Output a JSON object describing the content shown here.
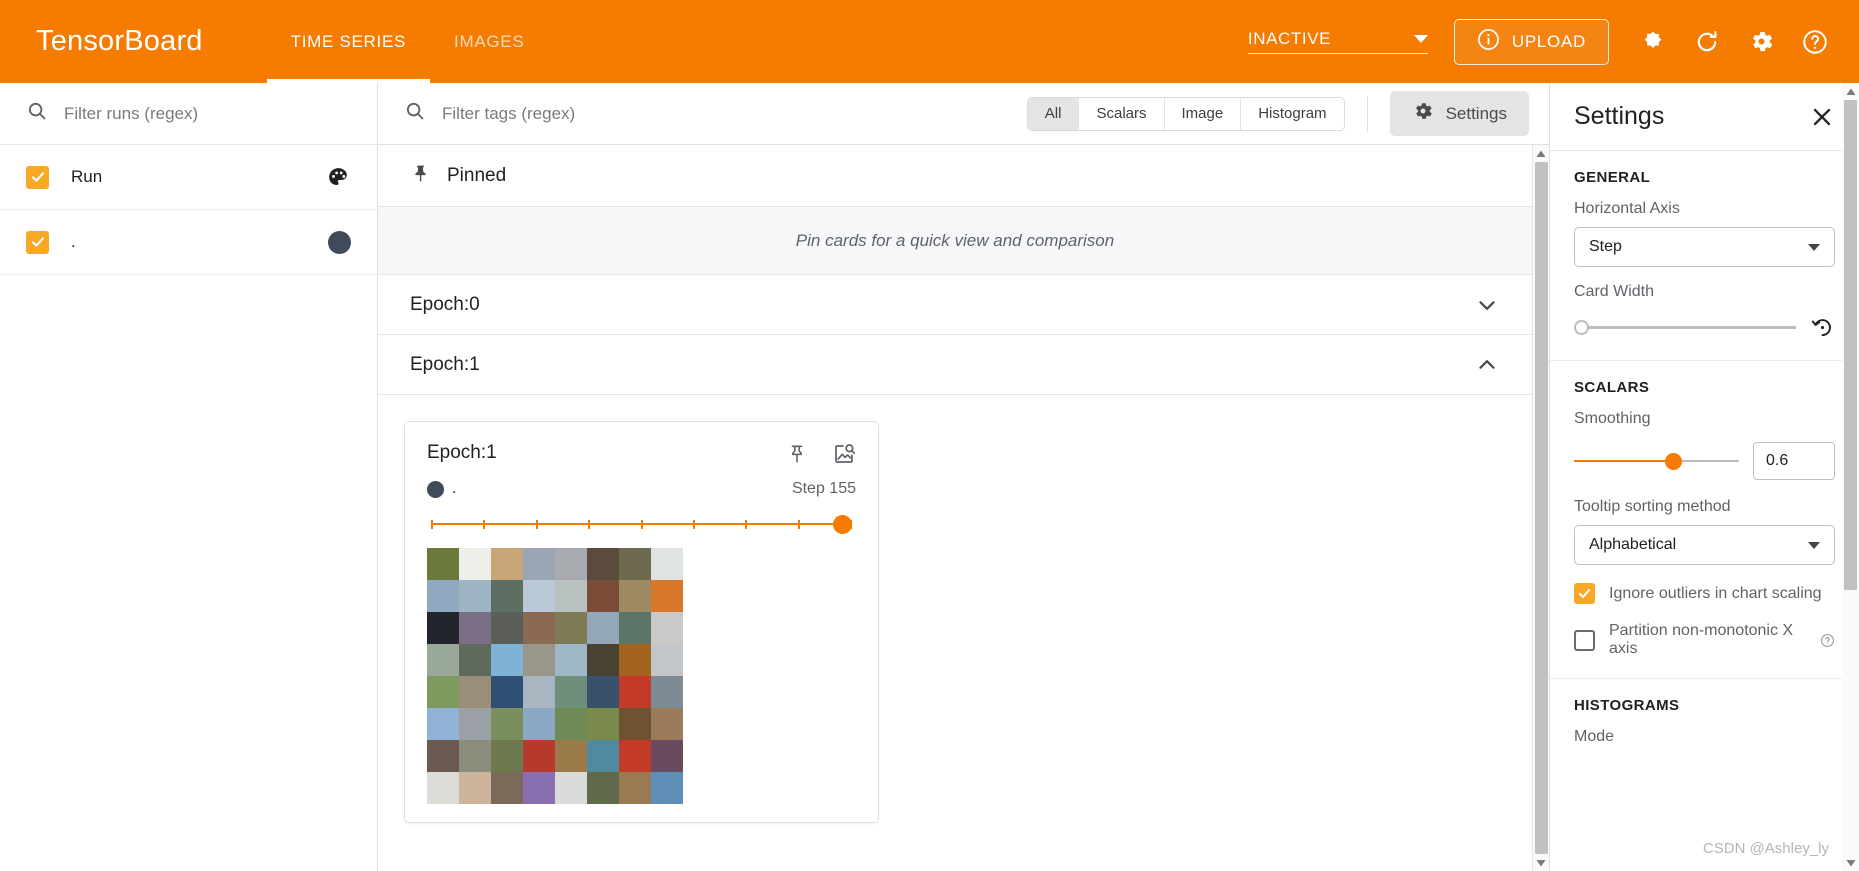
{
  "header": {
    "brand": "TensorBoard",
    "tabs": [
      {
        "label": "TIME SERIES",
        "active": true
      },
      {
        "label": "IMAGES",
        "active": false
      }
    ],
    "run_status": "INACTIVE",
    "upload_label": "UPLOAD",
    "icons": [
      "info-icon",
      "brightness-icon",
      "refresh-icon",
      "gear-icon",
      "help-icon"
    ],
    "accent_color": "#f57c00"
  },
  "sidebar": {
    "search_placeholder": "Filter runs (regex)",
    "runs_header": "Run",
    "runs": [
      {
        "label": ".",
        "checked": true,
        "color": "#3f4b5b"
      }
    ],
    "header_checked": true,
    "checkbox_color": "#f9a825"
  },
  "toolbar": {
    "tag_search_placeholder": "Filter tags (regex)",
    "filters": [
      {
        "label": "All",
        "active": true
      },
      {
        "label": "Scalars",
        "active": false
      },
      {
        "label": "Image",
        "active": false
      },
      {
        "label": "Histogram",
        "active": false
      }
    ],
    "settings_label": "Settings"
  },
  "main": {
    "pinned_title": "Pinned",
    "pinned_empty_text": "Pin cards for a quick view and comparison",
    "groups": [
      {
        "title": "Epoch:0",
        "expanded": false
      },
      {
        "title": "Epoch:1",
        "expanded": true
      }
    ],
    "card": {
      "title": "Epoch:1",
      "run_name": ".",
      "run_color": "#3f4b5b",
      "step_label": "Step 155",
      "slider_value": 155,
      "slider_ticks": 9,
      "grid_rows": 8,
      "grid_cols": 8
    }
  },
  "settings": {
    "title": "Settings",
    "close_icon": "close-icon",
    "sections": {
      "general": {
        "heading": "GENERAL",
        "horizontal_axis_label": "Horizontal Axis",
        "horizontal_axis_value": "Step",
        "card_width_label": "Card Width",
        "card_width_value": 0,
        "reset_icon": "reset-icon"
      },
      "scalars": {
        "heading": "SCALARS",
        "smoothing_label": "Smoothing",
        "smoothing_value": "0.6",
        "tooltip_sort_label": "Tooltip sorting method",
        "tooltip_sort_value": "Alphabetical",
        "ignore_outliers_label": "Ignore outliers in chart scaling",
        "ignore_outliers_checked": true,
        "partition_label": "Partition non-monotonic X axis",
        "partition_checked": false
      },
      "histograms": {
        "heading": "HISTOGRAMS",
        "mode_label": "Mode"
      }
    }
  },
  "watermark": "CSDN @Ashley_ly",
  "image_grid": [
    "#6b7a3a",
    "#efefe9",
    "#c9a678",
    "#9aa6b4",
    "#a7aaae",
    "#5a4b3c",
    "#6d6a4e",
    "#dfe3e2",
    "#8fa9c0",
    "#9fb4c4",
    "#5c6f62",
    "#b9c9d8",
    "#b7c2c0",
    "#7a4b36",
    "#a08a63",
    "#d8762a",
    "#20262c",
    "#7b6f86",
    "#5b5f57",
    "#8a6a52",
    "#7e7a55",
    "#93a7bb",
    "#5d7566",
    "#c9c9c7",
    "#9aa89a",
    "#5e6a5b",
    "#7fb3d5",
    "#9a968c",
    "#9fb8c8",
    "#4a4334",
    "#a2641f",
    "#c2c6c9",
    "#7e9a5e",
    "#9a8e78",
    "#2f4f75",
    "#a8b6c2",
    "#6f8f7a",
    "#39516a",
    "#c33a28",
    "#7c8a93",
    "#8fb2d6",
    "#9aa0a6",
    "#7a8e5e",
    "#8aa8c4",
    "#6e8a55",
    "#7a8a4a",
    "#6f5230",
    "#9a7c5a",
    "#6b5a52",
    "#8a8e7a",
    "#6d7a4e",
    "#b53a2c",
    "#9a7a46",
    "#4f8aa0",
    "#c43a26",
    "#6a4a5e",
    "#dcdcd6",
    "#cdb49a",
    "#7a6a5a",
    "#8a6fb0",
    "#d9dbd8",
    "#5f6a4a",
    "#9a7a52",
    "#5f8fb8"
  ]
}
